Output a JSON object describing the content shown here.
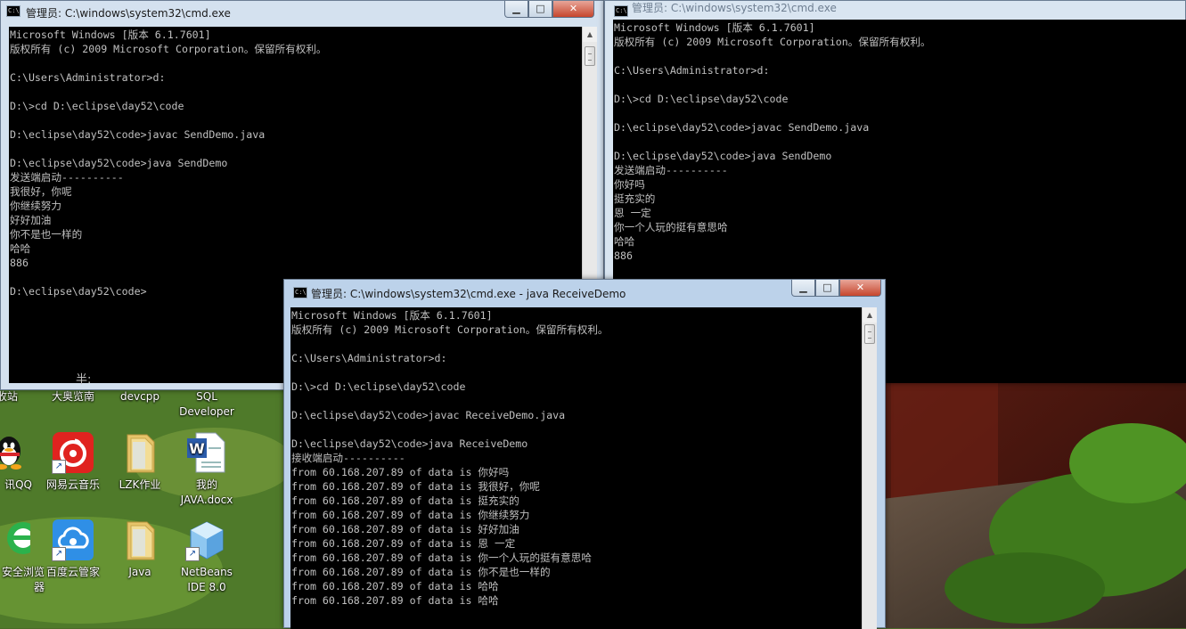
{
  "desktop": {
    "partial_labels": {
      "col1_top": "收站",
      "col2_top": "大奥览南",
      "col3_top": "devcpp",
      "col4_top": "SQL\nDeveloper",
      "ime_fragment": "半:"
    },
    "icons": [
      {
        "name": "qq",
        "label": "讯QQ",
        "icon": "qq-penguin-icon"
      },
      {
        "name": "netease-music",
        "label": "网易云音乐",
        "icon": "netease-cloud-music-icon"
      },
      {
        "name": "lzk-homework",
        "label": "LZK作业",
        "icon": "folder-icon"
      },
      {
        "name": "my-java-docx",
        "label": "我的\nJAVA.docx",
        "icon": "word-document-icon"
      },
      {
        "name": "secure-browser",
        "label": "安全浏览\n器",
        "icon": "browser-icon"
      },
      {
        "name": "baidu-cloud",
        "label": "百度云管家",
        "icon": "baidu-cloud-icon"
      },
      {
        "name": "java-folder",
        "label": "Java",
        "icon": "folder-icon"
      },
      {
        "name": "netbeans",
        "label": "NetBeans\nIDE 8.0",
        "icon": "netbeans-cube-icon"
      }
    ]
  },
  "windows": {
    "send1": {
      "title": "管理员: C:\\windows\\system32\\cmd.exe",
      "lines": [
        "Microsoft Windows [版本 6.1.7601]",
        "版权所有 (c) 2009 Microsoft Corporation。保留所有权利。",
        "",
        "C:\\Users\\Administrator>d:",
        "",
        "D:\\>cd D:\\eclipse\\day52\\code",
        "",
        "D:\\eclipse\\day52\\code>javac SendDemo.java",
        "",
        "D:\\eclipse\\day52\\code>java SendDemo",
        "发送端启动----------",
        "我很好，你呢",
        "你继续努力",
        "好好加油",
        "你不是也一样的",
        "哈哈",
        "886",
        "",
        "D:\\eclipse\\day52\\code>"
      ]
    },
    "send2": {
      "title": "管理员: C:\\windows\\system32\\cmd.exe",
      "lines": [
        "Microsoft Windows [版本 6.1.7601]",
        "版权所有 (c) 2009 Microsoft Corporation。保留所有权利。",
        "",
        "C:\\Users\\Administrator>d:",
        "",
        "D:\\>cd D:\\eclipse\\day52\\code",
        "",
        "D:\\eclipse\\day52\\code>javac SendDemo.java",
        "",
        "D:\\eclipse\\day52\\code>java SendDemo",
        "发送端启动----------",
        "你好吗",
        "挺充实的",
        "恩 一定",
        "你一个人玩的挺有意思哈",
        "哈哈",
        "886"
      ]
    },
    "receive": {
      "title": "管理员: C:\\windows\\system32\\cmd.exe - java  ReceiveDemo",
      "lines": [
        "Microsoft Windows [版本 6.1.7601]",
        "版权所有 (c) 2009 Microsoft Corporation。保留所有权利。",
        "",
        "C:\\Users\\Administrator>d:",
        "",
        "D:\\>cd D:\\eclipse\\day52\\code",
        "",
        "D:\\eclipse\\day52\\code>javac ReceiveDemo.java",
        "",
        "D:\\eclipse\\day52\\code>java ReceiveDemo",
        "接收端启动----------",
        "from 60.168.207.89 of data is 你好吗",
        "from 60.168.207.89 of data is 我很好，你呢",
        "from 60.168.207.89 of data is 挺充实的",
        "from 60.168.207.89 of data is 你继续努力",
        "from 60.168.207.89 of data is 好好加油",
        "from 60.168.207.89 of data is 恩 一定",
        "from 60.168.207.89 of data is 你一个人玩的挺有意思哈",
        "from 60.168.207.89 of data is 你不是也一样的",
        "from 60.168.207.89 of data is 哈哈",
        "from 60.168.207.89 of data is 哈哈"
      ]
    }
  },
  "window_controls": {
    "minimize": "▁",
    "maximize": "□",
    "close": "✕"
  },
  "colors": {
    "console_bg": "#000000",
    "console_text": "#c0c0c0",
    "titlebar": "#d4e1ef",
    "close_button": "#c6462d"
  }
}
